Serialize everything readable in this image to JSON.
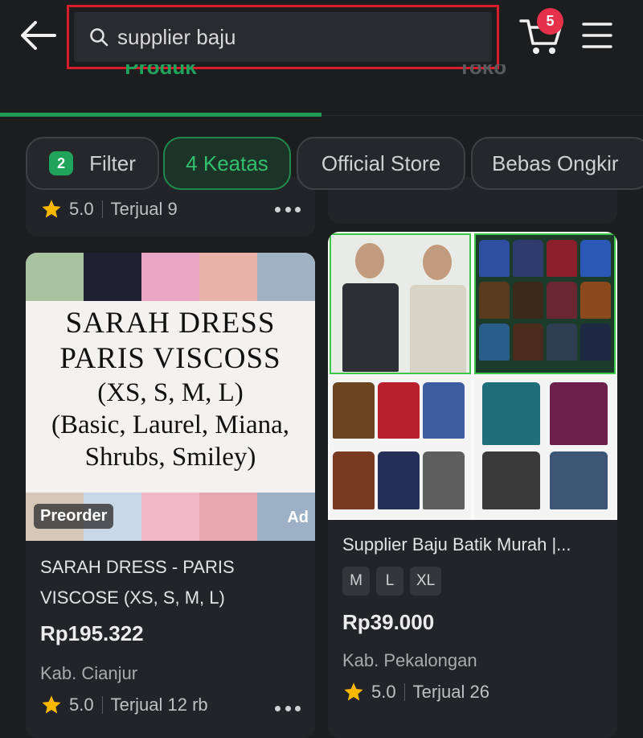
{
  "search": {
    "query": "supplier baju"
  },
  "cart": {
    "badge_count": "5"
  },
  "tabs": [
    {
      "label": "Produk"
    },
    {
      "label": "Toko"
    }
  ],
  "filters": {
    "filter_count": "2",
    "filter_label": "Filter",
    "chips": [
      {
        "label": "4 Keatas"
      },
      {
        "label": "Official Store"
      },
      {
        "label": "Bebas Ongkir"
      }
    ]
  },
  "products": {
    "top_left": {
      "rating": "5.0",
      "sold": "Terjual 9"
    },
    "left": {
      "image_text": {
        "line1": "SARAH DRESS",
        "line2": "PARIS VISCOSS",
        "line3": "(XS, S, M, L)",
        "line4": "(Basic, Laurel, Miana,",
        "line5": "Shrubs, Smiley)"
      },
      "badge": "Preorder",
      "ad_label": "Ad",
      "title_line1": "SARAH DRESS - PARIS",
      "title_line2": "VISCOSE (XS, S, M, L)",
      "price": "Rp195.322",
      "location": "Kab. Cianjur",
      "rating": "5.0",
      "sold": "Terjual 12 rb"
    },
    "right": {
      "title": "Supplier Baju Batik Murah |...",
      "sizes": [
        "M",
        "L",
        "XL"
      ],
      "price": "Rp39.000",
      "location": "Kab. Pekalongan",
      "rating": "5.0",
      "sold": "Terjual 26"
    }
  },
  "colors": {
    "accent_green": "#20a45b",
    "badge_red": "#e5324a",
    "highlight_red": "#d81e2a",
    "star_yellow": "#f6b700"
  }
}
